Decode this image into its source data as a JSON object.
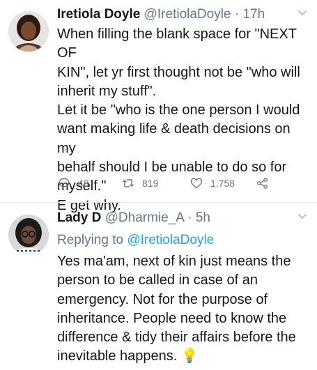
{
  "tweets": [
    {
      "name": "Iretiola Doyle",
      "handle": "@IretiolaDoyle",
      "separator": "·",
      "time": "17h",
      "lines": [
        "When filling the blank space for \"NEXT OF",
        "KIN\", let yr first thought not be \"who will",
        "inherit my stuff\".",
        "Let it be \"who is the one person I would",
        "want making life & death decisions on my",
        "behalf should I be unable to do so for",
        "myself.\"",
        "E get why."
      ],
      "replies": "48",
      "retweets": "819",
      "likes": "1,758"
    },
    {
      "name": "Lady D",
      "handle": "@Dharmie_A",
      "separator": "·",
      "time": "5h",
      "replying_prefix": "Replying to",
      "replying_to": "@IretiolaDoyle",
      "lines": [
        "Yes ma'am, next of kin just means the",
        "person to be called in case of an",
        "emergency. Not for the purpose of",
        "inheritance. People need to know the",
        "difference & tidy their affairs before the",
        "inevitable happens."
      ],
      "emoji": "💡"
    }
  ],
  "colors": {
    "text": "#14171a",
    "muted": "#657786",
    "link": "#1da1f2",
    "divider": "#e1e8ed"
  },
  "icons": [
    "chevron-down-icon",
    "reply-icon",
    "retweet-icon",
    "like-icon",
    "share-icon",
    "lightbulb-icon"
  ]
}
